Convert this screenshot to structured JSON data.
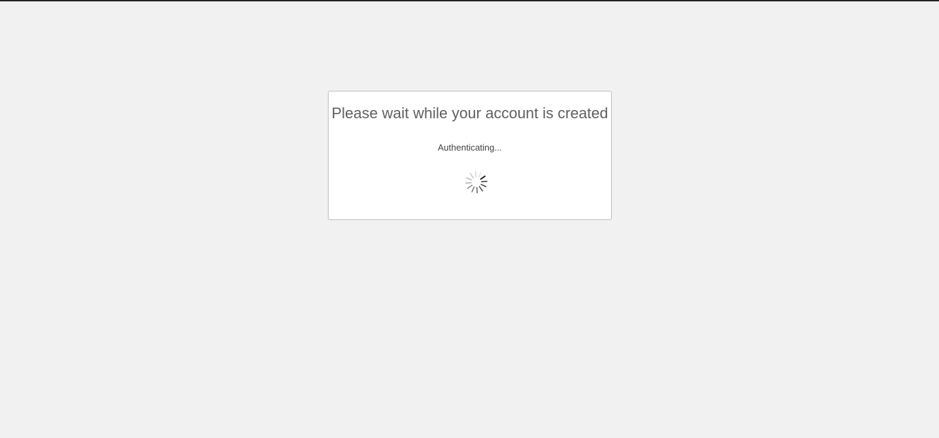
{
  "dialog": {
    "title": "Please wait while your account is created",
    "status": "Authenticating..."
  },
  "spinner": {
    "icon": "loading-spinner-icon",
    "color": "#222222"
  },
  "colors": {
    "page_background": "#f1f1f1",
    "dialog_background": "#ffffff",
    "title_text": "#5f5f5f",
    "status_text": "#444444",
    "top_rule": "#222222"
  }
}
